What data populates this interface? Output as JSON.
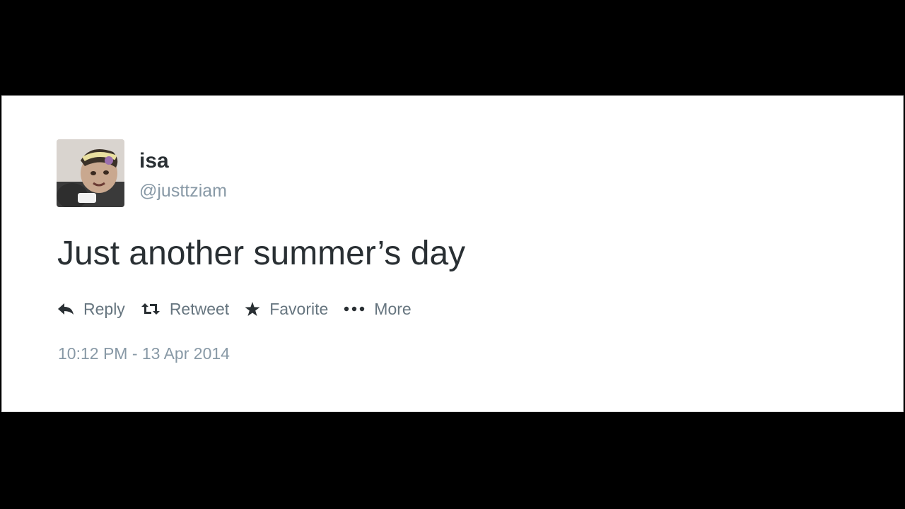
{
  "tweet": {
    "display_name": "isa",
    "handle": "@justtziam",
    "text": "Just another summer’s day",
    "timestamp": "10:12 PM - 13 Apr 2014"
  },
  "actions": {
    "reply": {
      "label": "Reply",
      "icon": "reply-arrow-icon"
    },
    "retweet": {
      "label": "Retweet",
      "icon": "retweet-icon"
    },
    "favorite": {
      "label": "Favorite",
      "icon": "star-icon"
    },
    "more": {
      "label": "More",
      "icon": "ellipsis-icon"
    }
  },
  "colors": {
    "page_background": "#000000",
    "card_background": "#ffffff",
    "name_text": "#292f33",
    "secondary_text": "#8899a6",
    "action_text": "#66757f"
  }
}
